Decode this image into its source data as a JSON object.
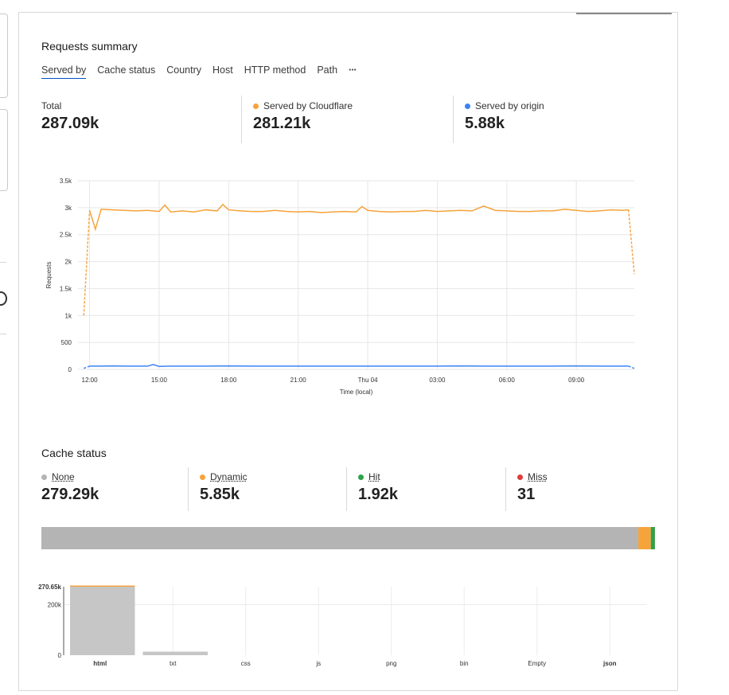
{
  "requests_summary": {
    "title": "Requests summary",
    "tabs": [
      "Served by",
      "Cache status",
      "Country",
      "Host",
      "HTTP method",
      "Path"
    ],
    "more_label": "···",
    "stats": [
      {
        "label": "Total",
        "value": "287.09k",
        "color": ""
      },
      {
        "label": "Served by Cloudflare",
        "value": "281.21k",
        "color": "#f6a33c"
      },
      {
        "label": "Served by origin",
        "value": "5.88k",
        "color": "#3c82f6"
      }
    ]
  },
  "cache_status": {
    "title": "Cache status",
    "stats": [
      {
        "label": "None",
        "value": "279.29k",
        "color": "#b4b4b4"
      },
      {
        "label": "Dynamic",
        "value": "5.85k",
        "color": "#f6a33c"
      },
      {
        "label": "Hit",
        "value": "1.92k",
        "color": "#2ca34b"
      },
      {
        "label": "Miss",
        "value": "31",
        "color": "#e23b3b"
      }
    ]
  },
  "chart_data": [
    {
      "type": "line",
      "xlabel": "Time (local)",
      "ylabel": "Requests",
      "ylim": [
        0,
        3500
      ],
      "y_ticks": [
        "0",
        "500",
        "1k",
        "1.5k",
        "2k",
        "2.5k",
        "3k",
        "3.5k"
      ],
      "x_ticks": [
        "12:00",
        "15:00",
        "18:00",
        "21:00",
        "Thu 04",
        "03:00",
        "06:00",
        "09:00"
      ],
      "x_hours": [
        0,
        3,
        6,
        9,
        12,
        15,
        18,
        21
      ],
      "grid": true,
      "series": [
        {
          "name": "Served by Cloudflare",
          "color": "#f6a33c",
          "x": [
            -0.25,
            0,
            0.25,
            0.5,
            1,
            1.5,
            2,
            2.5,
            3,
            3.25,
            3.5,
            4,
            4.5,
            5,
            5.5,
            5.75,
            6,
            6.5,
            7,
            7.5,
            8,
            8.5,
            9,
            9.5,
            10,
            10.5,
            11,
            11.5,
            11.75,
            12,
            12.5,
            13,
            13.5,
            14,
            14.5,
            15,
            15.5,
            16,
            16.5,
            17,
            17.5,
            18,
            18.5,
            19,
            19.5,
            20,
            20.5,
            21,
            21.5,
            22,
            22.5,
            23,
            23.25,
            23.5
          ],
          "y": [
            1000,
            2950,
            2600,
            2970,
            2960,
            2950,
            2940,
            2950,
            2930,
            3050,
            2920,
            2940,
            2920,
            2960,
            2940,
            3060,
            2960,
            2940,
            2930,
            2930,
            2950,
            2930,
            2920,
            2930,
            2910,
            2920,
            2930,
            2920,
            3020,
            2950,
            2930,
            2920,
            2930,
            2930,
            2950,
            2930,
            2940,
            2950,
            2940,
            3030,
            2950,
            2940,
            2930,
            2930,
            2940,
            2940,
            2970,
            2950,
            2930,
            2940,
            2960,
            2950,
            2960,
            1770
          ]
        },
        {
          "name": "Served by origin",
          "color": "#3c82f6",
          "x": [
            -0.25,
            0,
            0.5,
            1,
            1.5,
            2,
            2.5,
            2.75,
            3,
            3.5,
            4,
            5,
            6,
            7,
            8,
            9,
            10,
            11,
            12,
            13,
            14,
            15,
            16,
            17,
            18,
            19,
            20,
            21,
            22,
            23,
            23.25,
            23.5
          ],
          "y": [
            20,
            60,
            60,
            65,
            60,
            60,
            60,
            90,
            55,
            60,
            60,
            60,
            65,
            60,
            60,
            60,
            60,
            60,
            60,
            60,
            60,
            60,
            65,
            60,
            60,
            60,
            60,
            65,
            60,
            60,
            60,
            20
          ]
        }
      ]
    },
    {
      "type": "bar",
      "categories": [
        "html",
        "txt",
        "css",
        "js",
        "png",
        "bin",
        "Empty",
        "json"
      ],
      "bold_categories": [
        "html",
        "json"
      ],
      "y_ticks": [
        "0",
        "200k",
        "270.65k"
      ],
      "y_tick_values": [
        0,
        200000,
        270650
      ],
      "ylim": [
        0,
        270650
      ],
      "series": [
        {
          "name": "None",
          "color": "#c6c6c6",
          "values": [
            270650,
            14000,
            0,
            0,
            0,
            0,
            0,
            0
          ]
        },
        {
          "name": "Dynamic",
          "color": "#f6a33c",
          "values": [
            800,
            0,
            0,
            0,
            0,
            0,
            0,
            0
          ]
        }
      ]
    },
    {
      "type": "bar",
      "orientation": "stacked-horizontal",
      "categories": [
        "None",
        "Dynamic",
        "Hit",
        "Miss"
      ],
      "values": [
        279290,
        5850,
        1920,
        31
      ],
      "colors": [
        "#b4b4b4",
        "#f6a33c",
        "#2ca34b",
        "#e23b3b"
      ]
    }
  ]
}
